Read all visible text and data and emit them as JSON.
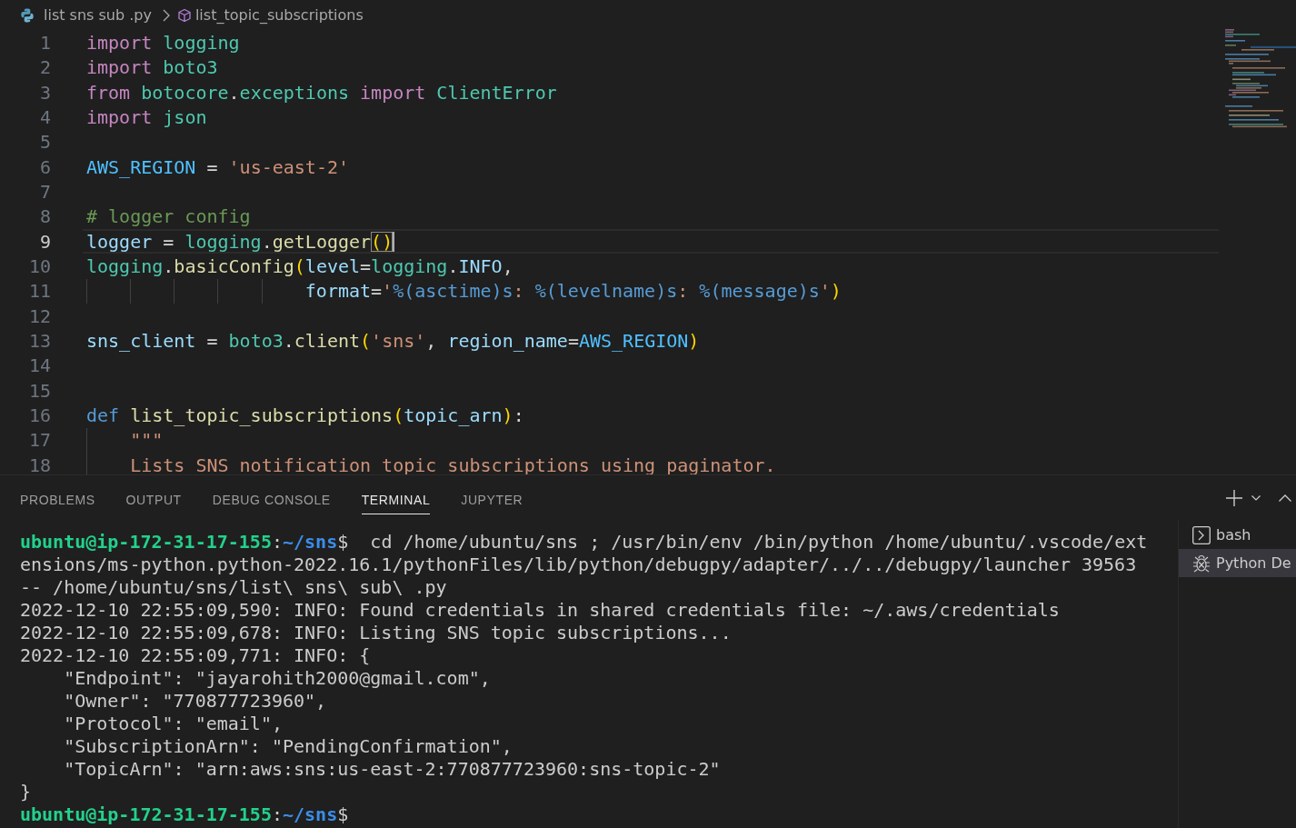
{
  "breadcrumb": {
    "file": "list sns sub .py",
    "symbol": "list_topic_subscriptions"
  },
  "editor": {
    "lines": [
      {
        "number": "1",
        "current": false,
        "tokens": [
          {
            "text": "import ",
            "kind": "keyword"
          },
          {
            "text": "logging",
            "kind": "module"
          }
        ]
      },
      {
        "number": "2",
        "current": false,
        "tokens": [
          {
            "text": "import ",
            "kind": "keyword"
          },
          {
            "text": "boto3",
            "kind": "module"
          }
        ]
      },
      {
        "number": "3",
        "current": false,
        "tokens": [
          {
            "text": "from ",
            "kind": "keyword"
          },
          {
            "text": "botocore",
            "kind": "module"
          },
          {
            "text": ".",
            "kind": "plain"
          },
          {
            "text": "exceptions ",
            "kind": "module"
          },
          {
            "text": "import ",
            "kind": "keyword"
          },
          {
            "text": "ClientError",
            "kind": "module"
          }
        ]
      },
      {
        "number": "4",
        "current": false,
        "tokens": [
          {
            "text": "import ",
            "kind": "keyword"
          },
          {
            "text": "json",
            "kind": "module"
          }
        ]
      },
      {
        "number": "5",
        "current": false
      },
      {
        "number": "6",
        "current": false,
        "tokens": [
          {
            "text": "AWS_REGION",
            "kind": "constant"
          },
          {
            "text": " = ",
            "kind": "plain"
          },
          {
            "text": "'us-east-2'",
            "kind": "string"
          }
        ]
      },
      {
        "number": "7",
        "current": false
      },
      {
        "number": "8",
        "current": false,
        "tokens": [
          {
            "text": "# logger config",
            "kind": "comment"
          }
        ]
      },
      {
        "number": "9",
        "current": true,
        "tokens": [
          {
            "text": "logger",
            "kind": "variable"
          },
          {
            "text": " = ",
            "kind": "plain"
          },
          {
            "text": "logging",
            "kind": "module"
          },
          {
            "text": ".",
            "kind": "plain"
          },
          {
            "text": "getLogger",
            "kind": "function"
          },
          {
            "text": "()",
            "kind": "bracket-match"
          }
        ]
      },
      {
        "number": "10",
        "current": false,
        "tokens": [
          {
            "text": "logging",
            "kind": "module"
          },
          {
            "text": ".",
            "kind": "plain"
          },
          {
            "text": "basicConfig",
            "kind": "function"
          },
          {
            "text": "(",
            "kind": "bracket"
          },
          {
            "text": "level",
            "kind": "variable"
          },
          {
            "text": "=",
            "kind": "plain"
          },
          {
            "text": "logging",
            "kind": "module"
          },
          {
            "text": ".",
            "kind": "plain"
          },
          {
            "text": "INFO",
            "kind": "variable"
          },
          {
            "text": ",",
            "kind": "plain"
          }
        ]
      },
      {
        "number": "11",
        "current": false,
        "tokens": [
          {
            "text": "                    format",
            "kind": "variable"
          },
          {
            "text": "=",
            "kind": "plain"
          },
          {
            "text": "'",
            "kind": "string"
          },
          {
            "text": "%(asctime)s",
            "kind": "format"
          },
          {
            "text": ": ",
            "kind": "string"
          },
          {
            "text": "%(levelname)s",
            "kind": "format"
          },
          {
            "text": ": ",
            "kind": "string"
          },
          {
            "text": "%(message)s",
            "kind": "format"
          },
          {
            "text": "'",
            "kind": "string"
          },
          {
            "text": ")",
            "kind": "bracket"
          }
        ]
      },
      {
        "number": "12",
        "current": false
      },
      {
        "number": "13",
        "current": false,
        "tokens": [
          {
            "text": "sns_client",
            "kind": "variable"
          },
          {
            "text": " = ",
            "kind": "plain"
          },
          {
            "text": "boto3",
            "kind": "module"
          },
          {
            "text": ".",
            "kind": "plain"
          },
          {
            "text": "client",
            "kind": "function"
          },
          {
            "text": "(",
            "kind": "bracket"
          },
          {
            "text": "'sns'",
            "kind": "string"
          },
          {
            "text": ", ",
            "kind": "plain"
          },
          {
            "text": "region_name",
            "kind": "variable"
          },
          {
            "text": "=",
            "kind": "plain"
          },
          {
            "text": "AWS_REGION",
            "kind": "constant"
          },
          {
            "text": ")",
            "kind": "bracket"
          }
        ]
      },
      {
        "number": "14",
        "current": false
      },
      {
        "number": "15",
        "current": false
      },
      {
        "number": "16",
        "current": false,
        "tokens": [
          {
            "text": "def ",
            "kind": "storage"
          },
          {
            "text": "list_topic_subscriptions",
            "kind": "function"
          },
          {
            "text": "(",
            "kind": "bracket"
          },
          {
            "text": "topic_arn",
            "kind": "variable"
          },
          {
            "text": ")",
            "kind": "bracket"
          },
          {
            "text": ":",
            "kind": "plain"
          }
        ]
      },
      {
        "number": "17",
        "current": false,
        "tokens": [
          {
            "text": "    \"\"\"",
            "kind": "string"
          }
        ]
      },
      {
        "number": "18",
        "current": false,
        "tokens": [
          {
            "text": "    Lists SNS notification topic subscriptions using paginator.",
            "kind": "string"
          }
        ]
      }
    ]
  },
  "panel": {
    "tabs": [
      {
        "label": "PROBLEMS",
        "selected": false
      },
      {
        "label": "OUTPUT",
        "selected": false
      },
      {
        "label": "DEBUG CONSOLE",
        "selected": false
      },
      {
        "label": "TERMINAL",
        "selected": true
      },
      {
        "label": "JUPYTER",
        "selected": false
      }
    ]
  },
  "terminal": {
    "lines": [
      {
        "segments": [
          {
            "text": "ubuntu@ip-172-31-17-155",
            "kind": "user"
          },
          {
            "text": ":",
            "kind": "plain"
          },
          {
            "text": "~/sns",
            "kind": "path"
          },
          {
            "text": "$",
            "kind": "plain"
          },
          {
            "text": "cd /home/ubuntu/sns ; /usr/bin/env /bin/python /home/ubuntu/.vscode/ext",
            "kind": "command"
          }
        ]
      },
      {
        "segments": [
          {
            "text": "ensions/ms-python.python-2022.16.1/pythonFiles/lib/python/debugpy/adapter/../../debugpy/launcher 39563",
            "kind": "plain"
          }
        ]
      },
      {
        "segments": [
          {
            "text": "-- /home/ubuntu/sns/list\\ sns\\ sub\\ .py",
            "kind": "plain"
          }
        ]
      },
      {
        "segments": [
          {
            "text": "2022-12-10 22:55:09,590: INFO: Found credentials in shared credentials file: ~/.aws/credentials",
            "kind": "plain"
          }
        ]
      },
      {
        "segments": [
          {
            "text": "2022-12-10 22:55:09,678: INFO: Listing SNS topic subscriptions...",
            "kind": "plain"
          }
        ]
      },
      {
        "segments": [
          {
            "text": "2022-12-10 22:55:09,771: INFO: {",
            "kind": "plain"
          }
        ]
      },
      {
        "segments": [
          {
            "text": "    \"Endpoint\": \"jayarohith2000@gmail.com\",",
            "kind": "plain"
          }
        ]
      },
      {
        "segments": [
          {
            "text": "    \"Owner\": \"770877723960\",",
            "kind": "plain"
          }
        ]
      },
      {
        "segments": [
          {
            "text": "    \"Protocol\": \"email\",",
            "kind": "plain"
          }
        ]
      },
      {
        "segments": [
          {
            "text": "    \"SubscriptionArn\": \"PendingConfirmation\",",
            "kind": "plain"
          }
        ]
      },
      {
        "segments": [
          {
            "text": "    \"TopicArn\": \"arn:aws:sns:us-east-2:770877723960:sns-topic-2\"",
            "kind": "plain"
          }
        ]
      },
      {
        "segments": [
          {
            "text": "}",
            "kind": "plain"
          }
        ]
      },
      {
        "segments": [
          {
            "text": "ubuntu@ip-172-31-17-155",
            "kind": "user"
          },
          {
            "text": ":",
            "kind": "plain"
          },
          {
            "text": "~/sns",
            "kind": "path"
          },
          {
            "text": "$",
            "kind": "plain"
          }
        ]
      }
    ]
  },
  "terminal_list": [
    {
      "label": "bash",
      "kind": "shell",
      "selected": false
    },
    {
      "label": "Python De",
      "kind": "debug",
      "selected": true
    }
  ]
}
